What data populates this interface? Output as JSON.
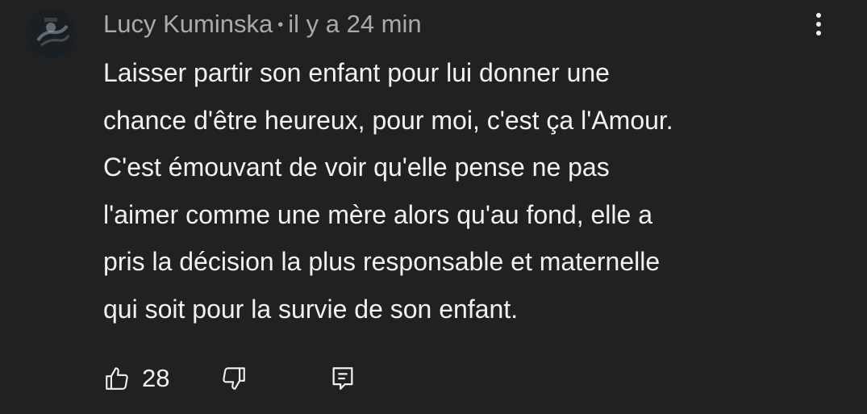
{
  "comment": {
    "author": "Lucy Kuminska",
    "separator": "•",
    "timestamp": "il y a 24 min",
    "text": "Laisser partir son enfant pour lui donner une\nchance d'être heureux, pour moi, c'est ça l'Amour.\nC'est émouvant de voir qu'elle pense ne pas\nl'aimer comme une mère alors qu'au fond, elle a\npris la décision la plus responsable et maternelle\nqui soit pour la survie de son enfant.",
    "like_count": "28"
  },
  "icons": {
    "like": "thumbs-up-icon",
    "dislike": "thumbs-down-icon",
    "reply": "reply-comment-icon",
    "menu": "more-vertical-icon"
  },
  "colors": {
    "background": "#212121",
    "text_primary": "#f1f1f1",
    "text_secondary": "#aaaaaa"
  }
}
